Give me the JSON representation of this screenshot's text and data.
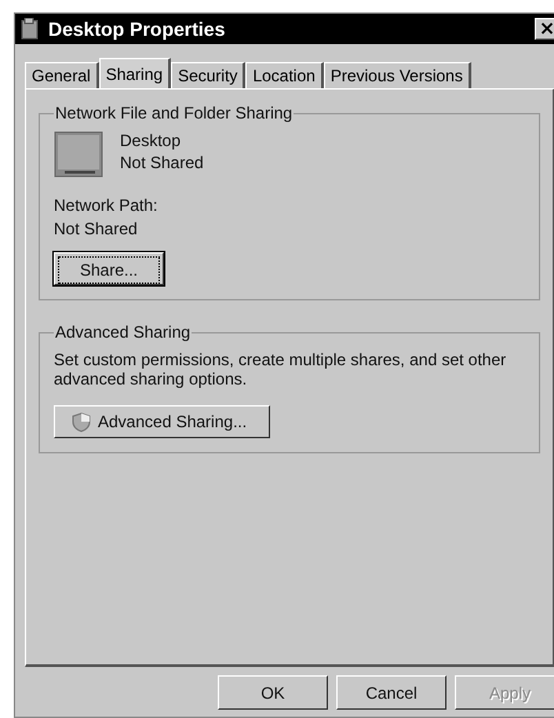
{
  "window": {
    "title": "Desktop Properties",
    "close": "×"
  },
  "tabs": [
    {
      "label": "General",
      "selected": false
    },
    {
      "label": "Sharing",
      "selected": true
    },
    {
      "label": "Security",
      "selected": false
    },
    {
      "label": "Location",
      "selected": false
    },
    {
      "label": "Previous Versions",
      "selected": false
    }
  ],
  "network_sharing": {
    "title": "Network File and Folder Sharing",
    "item_name": "Desktop",
    "item_status": "Not Shared",
    "path_label": "Network Path:",
    "path_value": "Not Shared",
    "button": "Share..."
  },
  "advanced_sharing": {
    "title": "Advanced Sharing",
    "description": "Set custom permissions, create multiple shares, and set other advanced sharing options.",
    "button": "Advanced Sharing..."
  },
  "buttons": [
    {
      "label": "OK",
      "disabled": false
    },
    {
      "label": "Cancel",
      "disabled": false
    },
    {
      "label": "Apply",
      "disabled": true
    }
  ]
}
